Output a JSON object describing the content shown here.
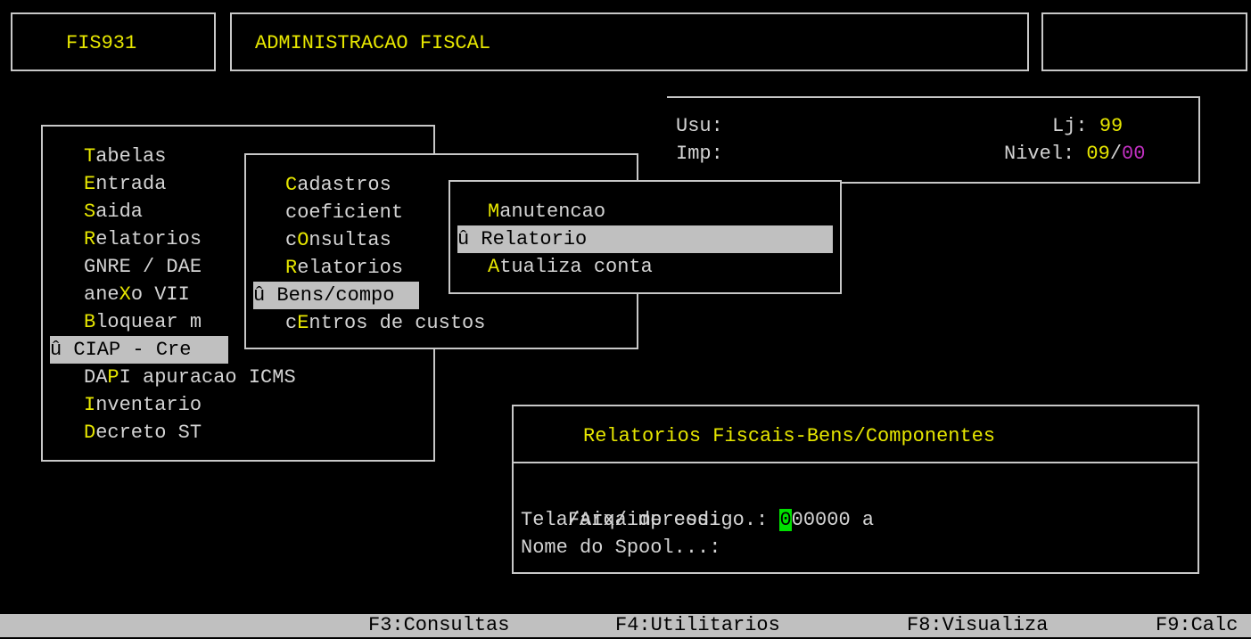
{
  "header": {
    "program_code": "FIS931",
    "program_title": "ADMINISTRACAO FISCAL",
    "right_box": ""
  },
  "info": {
    "usu_label": "Usu:",
    "imp_label": "Imp:",
    "lj_label": "Lj:",
    "lj_value": "99",
    "nivel_label": "Nivel:",
    "nivel_value_a": "09",
    "nivel_sep": "/",
    "nivel_value_b": "00"
  },
  "menu1": {
    "items": [
      {
        "hot": "T",
        "rest": "abelas"
      },
      {
        "hot": "E",
        "rest": "ntrada"
      },
      {
        "hot": "S",
        "rest": "aida"
      },
      {
        "hot": "R",
        "rest": "elatorios"
      },
      {
        "pre": "GNRE / DAE",
        "hot": "",
        "rest": ""
      },
      {
        "pre": "ane",
        "hot": "X",
        "rest": "o VII"
      },
      {
        "hot": "B",
        "rest": "loquear m"
      },
      {
        "marker": "û",
        "pre": "CIAP - Cre",
        "hot": "",
        "rest": ""
      },
      {
        "pre": "DA",
        "hot": "P",
        "rest": "I apuracao ICMS"
      },
      {
        "hot": "I",
        "rest": "nventario"
      },
      {
        "hot": "D",
        "rest": "ecreto ST"
      }
    ]
  },
  "menu2": {
    "items": [
      {
        "hot": "C",
        "rest": "adastros"
      },
      {
        "pre": "coeficient",
        "hot": "",
        "rest": ""
      },
      {
        "pre": "c",
        "hot": "O",
        "rest": "nsultas"
      },
      {
        "hot": "R",
        "rest": "elatorios"
      },
      {
        "marker": "û",
        "pre": "Bens/compo",
        "hot": "",
        "rest": ""
      },
      {
        "pre": "c",
        "hot": "E",
        "rest": "ntros de custos"
      }
    ]
  },
  "menu3": {
    "items": [
      {
        "hot": "M",
        "rest": "anutencao"
      },
      {
        "marker": "û",
        "pre": "Relatorio",
        "hot": "",
        "rest": ""
      },
      {
        "hot": "A",
        "rest": "tualiza conta"
      }
    ]
  },
  "dialog": {
    "title": "Relatorios Fiscais-Bens/Componentes",
    "faixa_label": "Faixa de codigo.:",
    "faixa_cursor": "0",
    "faixa_value_rest": "00000",
    "faixa_a": "a",
    "tela_label": "Tela/Arq/impress:",
    "spool_label": "Nome do Spool...:"
  },
  "fkeys": {
    "f3": "F3:Consultas",
    "f4": "F4:Utilitarios",
    "f8": "F8:Visualiza",
    "f9": "F9:Calc"
  }
}
